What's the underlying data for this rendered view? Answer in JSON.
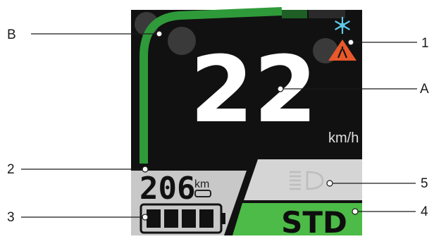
{
  "display": {
    "speed": "22",
    "speed_unit": "km/h",
    "odometer": "206",
    "odometer_unit": "km",
    "battery_bars": 4,
    "mode": "STD",
    "assist_arc_level": 0.9,
    "icons": [
      "snowflake-icon",
      "road-warning-icon",
      "headlight-icon",
      "battery-icon"
    ]
  },
  "callouts": {
    "B": "B",
    "A": "A",
    "n1": "1",
    "n2": "2",
    "n3": "3",
    "n4": "4",
    "n5": "5"
  },
  "colors": {
    "screen_bg": "#111111",
    "assist_green": "#2f9a3a",
    "mode_green": "#4cbb47",
    "odo_panel": "#c8c8c8",
    "light_panel": "#d5d5d5",
    "warning_orange": "#e8582a",
    "frost_blue": "#5ec8ea"
  }
}
